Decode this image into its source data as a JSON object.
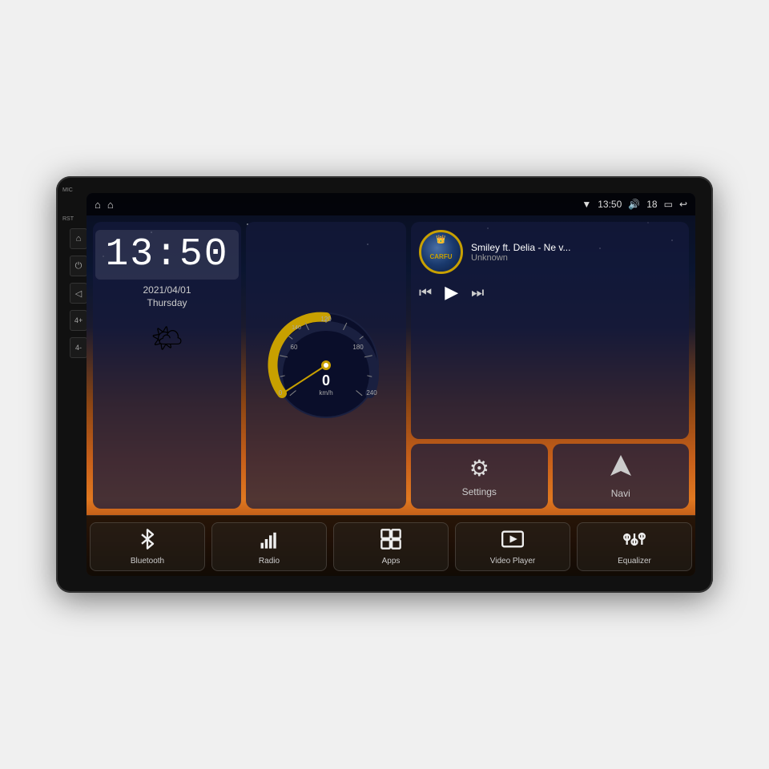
{
  "device": {
    "type": "car-head-unit"
  },
  "statusBar": {
    "leftIcons": [
      "⌂",
      "⌂"
    ],
    "time": "13:50",
    "volume": "18",
    "rightIcons": [
      "▼",
      "⏎"
    ]
  },
  "clock": {
    "time": "13:50",
    "date": "2021/04/01",
    "day": "Thursday"
  },
  "speedometer": {
    "speed": "0",
    "unit": "km/h",
    "maxSpeed": 240
  },
  "music": {
    "title": "Smiley ft. Delia - Ne v...",
    "artist": "Unknown",
    "albumBrand": "CARFU"
  },
  "sideButtons": {
    "micLabel": "MIC",
    "rstLabel": "RST",
    "buttons": [
      "⌂",
      "⟳",
      "◁",
      "4+",
      "4-"
    ]
  },
  "rightWidgets": {
    "settings": {
      "label": "Settings",
      "icon": "⚙"
    },
    "navi": {
      "label": "Navi",
      "icon": "◬"
    }
  },
  "bottomMenu": [
    {
      "id": "bluetooth",
      "label": "Bluetooth",
      "icon": "bluetooth"
    },
    {
      "id": "radio",
      "label": "Radio",
      "icon": "radio"
    },
    {
      "id": "apps",
      "label": "Apps",
      "icon": "apps"
    },
    {
      "id": "video-player",
      "label": "Video Player",
      "icon": "video"
    },
    {
      "id": "equalizer",
      "label": "Equalizer",
      "icon": "equalizer"
    }
  ],
  "colors": {
    "accent": "#c8a000",
    "screenBg": "#0a0e1f",
    "widgetBg": "rgba(20,25,60,0.75)",
    "textPrimary": "#ffffff",
    "textSecondary": "#cccccc"
  }
}
